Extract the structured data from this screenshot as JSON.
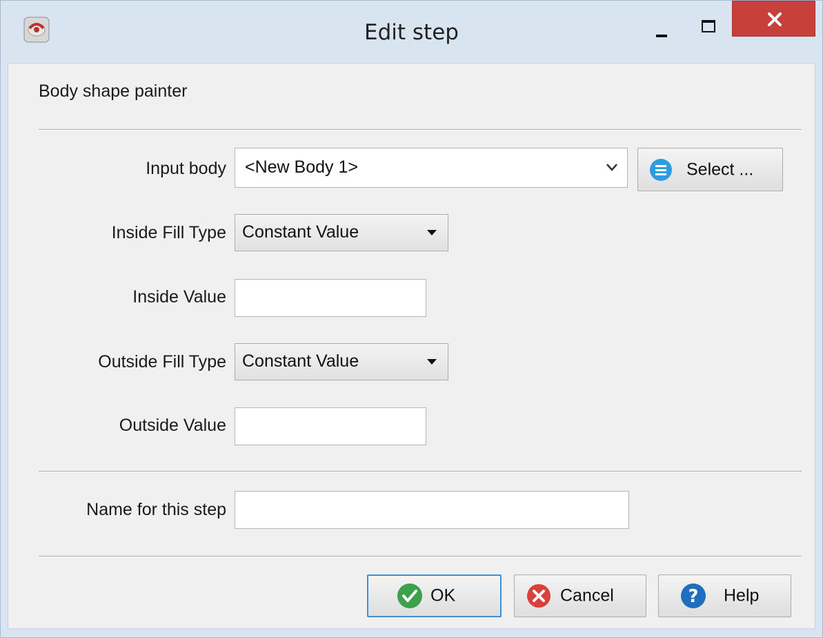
{
  "window": {
    "title": "Edit step"
  },
  "icons": {
    "app": "app-icon",
    "minimize": "minimize-icon",
    "maximize": "maximize-icon",
    "close": "close-icon",
    "select": "list-icon",
    "ok": "check-circle-icon",
    "cancel": "x-circle-icon",
    "help": "question-circle-icon"
  },
  "colors": {
    "close": "#c7403a",
    "ok_icon": "#3da04a",
    "cancel_icon": "#d9413c",
    "help_icon": "#1f6fbf",
    "select_icon": "#2f9be0"
  },
  "heading": "Body shape painter",
  "fields": {
    "input_body": {
      "label": "Input body",
      "value": "<New Body 1>",
      "select_label": "Select ..."
    },
    "inside_fill_type": {
      "label": "Inside Fill Type",
      "value": "Constant Value"
    },
    "inside_value": {
      "label": "Inside Value",
      "value": ""
    },
    "outside_fill_type": {
      "label": "Outside Fill Type",
      "value": "Constant Value"
    },
    "outside_value": {
      "label": "Outside Value",
      "value": ""
    },
    "step_name": {
      "label": "Name for this step",
      "value": ""
    }
  },
  "buttons": {
    "ok": "OK",
    "cancel": "Cancel",
    "help": "Help"
  }
}
